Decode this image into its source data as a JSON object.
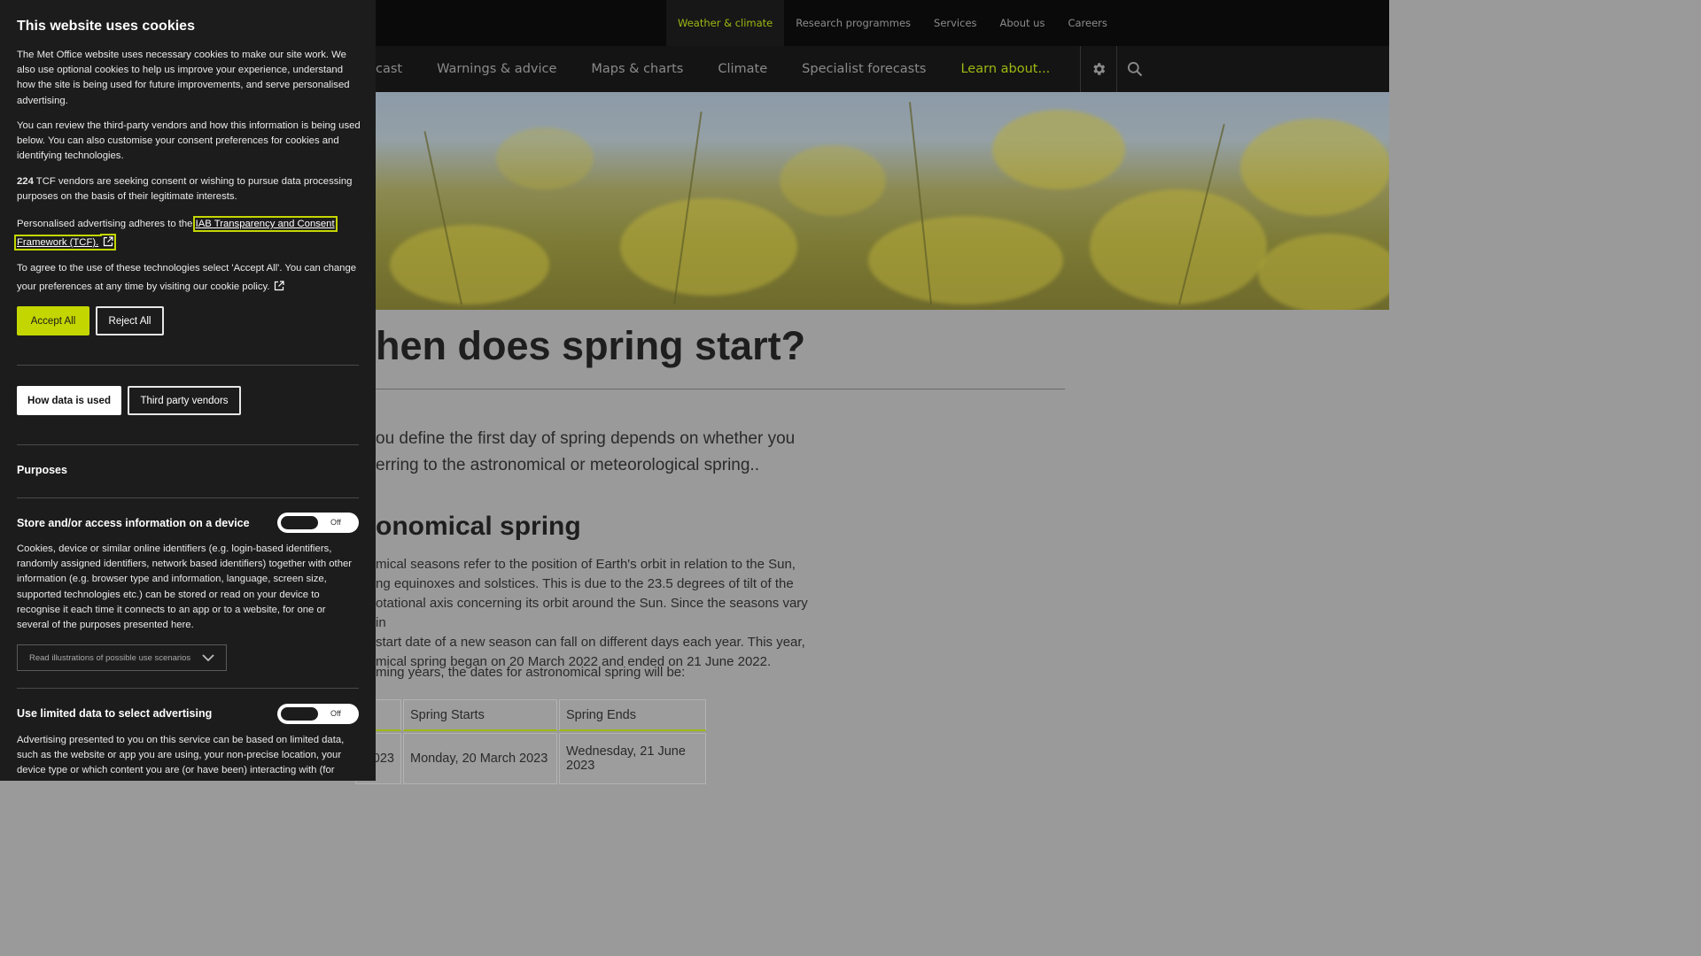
{
  "top_nav": [
    "Weather & climate",
    "Research programmes",
    "Services",
    "About us",
    "Careers"
  ],
  "main_nav": [
    "cast",
    "Warnings & advice",
    "Maps & charts",
    "Climate",
    "Specialist forecasts",
    "Learn about..."
  ],
  "icons": {
    "settings": "gear-icon",
    "search": "search-icon"
  },
  "colors": {
    "accent": "#c4d600",
    "active_nav": "#9fb813",
    "panel_bg": "#1c1c1c"
  },
  "article": {
    "title": "hen does spring start?",
    "intro_line1": "ou define the first day of spring depends on whether you",
    "intro_line2": "erring to the astronomical or meteorological spring..",
    "section_title": "onomical spring",
    "body_lines": [
      "mical seasons refer to the position of Earth's orbit in relation to the Sun,",
      "ng equinoxes and solstices. This is due to the 23.5 degrees of tilt of the",
      "otational axis concerning its orbit around the Sun. Since the seasons vary in",
      "start date of a new season can fall on different days each year. This year,",
      "mical spring began on 20 March 2022 and ended on 21 June 2022."
    ],
    "table_intro": "ming years, the dates for astronomical spring will be:",
    "table": {
      "headers": [
        "",
        "Spring Starts",
        "Spring Ends"
      ],
      "rows": [
        [
          "023",
          "Monday, 20 March 2023",
          "Wednesday, 21 June 2023"
        ]
      ]
    }
  },
  "cookie": {
    "title": "This website uses cookies",
    "p1": "The Met Office website uses necessary cookies to make our site work. We also use optional cookies to help us improve your experience, understand how the site is being used for future improvements, and serve personalised advertising.",
    "p2": "You can review the third-party vendors and how this information is being used below. You can also customise your consent preferences for cookies and identifying technologies.",
    "vendor_count": "224",
    "p3": " TCF vendors are seeking consent or wishing to pursue data processing purposes on the basis of their legitimate interests.",
    "p4_prefix": "Personalised advertising adheres to the ",
    "p4_link": "IAB Transparency and Consent Framework (TCF).",
    "p5": "To agree to the use of these technologies select 'Accept All'. You can change your preferences at any time by visiting our cookie policy.",
    "accept_label": "Accept All",
    "reject_label": "Reject All",
    "tab_how": "How data is used",
    "tab_vendors": "Third party vendors",
    "purposes_heading": "Purposes",
    "purpose1": {
      "title": "Store and/or access information on a device",
      "toggle": "Off",
      "desc": "Cookies, device or similar online identifiers (e.g. login-based identifiers, randomly assigned identifiers, network based identifiers) together with other information (e.g. browser type and information, language, screen size, supported technologies etc.) can be stored or read on your device to recognise it each time it connects to an app or to a website, for one or several of the purposes presented here.",
      "details_label": "Read illustrations of possible use scenarios"
    },
    "purpose2": {
      "title": "Use limited data to select advertising",
      "toggle": "Off",
      "desc": "Advertising presented to you on this service can be based on limited data, such as the website or app you are using, your non-precise location, your device type or which content you are (or have been) interacting with (for"
    }
  }
}
